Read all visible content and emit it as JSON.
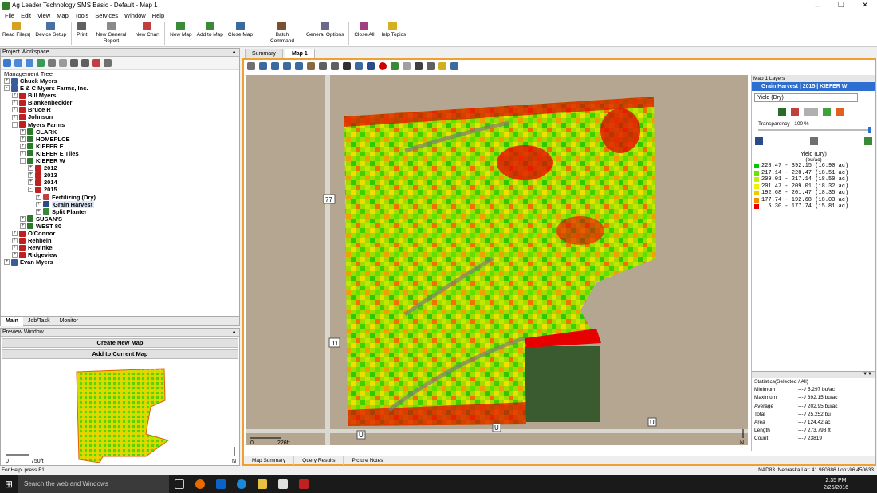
{
  "title": {
    "text": "Ag Leader Technology SMS Basic - Default - Map 1"
  },
  "menu": [
    "File",
    "Edit",
    "View",
    "Map",
    "Tools",
    "Services",
    "Window",
    "Help"
  ],
  "ribbon": [
    {
      "label": "Read File(s)",
      "icon": "folder-icon",
      "color": "#d6a020"
    },
    {
      "label": "Device Setup",
      "icon": "device-icon",
      "color": "#4a6fa5"
    },
    {
      "label": "Print",
      "icon": "print-icon",
      "color": "#606060"
    },
    {
      "label": "New General Report",
      "icon": "report-icon",
      "color": "#8a8a8a"
    },
    {
      "label": "New Chart",
      "icon": "chart-icon",
      "color": "#c04040"
    },
    {
      "label": "New Map",
      "icon": "new-map-icon",
      "color": "#3a8a3a"
    },
    {
      "label": "Add to Map",
      "icon": "add-map-icon",
      "color": "#3a8a3a"
    },
    {
      "label": "Close Map",
      "icon": "close-map-icon",
      "color": "#3a6aa0"
    },
    {
      "label": "Batch Command",
      "icon": "batch-icon",
      "color": "#7a5030"
    },
    {
      "label": "General Options",
      "icon": "options-icon",
      "color": "#6a6a8a"
    },
    {
      "label": "Close All",
      "icon": "close-all-icon",
      "color": "#a04080"
    },
    {
      "label": "Help Topics",
      "icon": "help-icon",
      "color": "#d4b020"
    }
  ],
  "workspace": {
    "title": "Project Workspace",
    "tree_label": "Management Tree",
    "nodes": [
      {
        "label": "Chuck Myers",
        "depth": 0,
        "exp": "+",
        "icon": "person-icon"
      },
      {
        "label": "E & C Myers Farms, Inc.",
        "depth": 0,
        "exp": "-",
        "icon": "person-icon"
      },
      {
        "label": "Bill Myers",
        "depth": 1,
        "exp": "+",
        "icon": "farm-icon"
      },
      {
        "label": "Blankenbeckler",
        "depth": 1,
        "exp": "+",
        "icon": "farm-icon"
      },
      {
        "label": "Bruce R",
        "depth": 1,
        "exp": "+",
        "icon": "farm-icon"
      },
      {
        "label": "Johnson",
        "depth": 1,
        "exp": "+",
        "icon": "farm-icon"
      },
      {
        "label": "Myers Farms",
        "depth": 1,
        "exp": "-",
        "icon": "farm-icon"
      },
      {
        "label": "CLARK",
        "depth": 2,
        "exp": "+",
        "icon": "field-icon"
      },
      {
        "label": "HOMEPLCE",
        "depth": 2,
        "exp": "+",
        "icon": "field-icon"
      },
      {
        "label": "KIEFER E",
        "depth": 2,
        "exp": "+",
        "icon": "field-icon"
      },
      {
        "label": "KIEFER E Tiles",
        "depth": 2,
        "exp": "+",
        "icon": "field-icon"
      },
      {
        "label": "KIEFER W",
        "depth": 2,
        "exp": "-",
        "icon": "field-icon"
      },
      {
        "label": "2012",
        "depth": 3,
        "exp": "+",
        "icon": "year-icon"
      },
      {
        "label": "2013",
        "depth": 3,
        "exp": "+",
        "icon": "year-icon"
      },
      {
        "label": "2014",
        "depth": 3,
        "exp": "+",
        "icon": "year-icon"
      },
      {
        "label": "2015",
        "depth": 3,
        "exp": "-",
        "icon": "year-icon"
      },
      {
        "label": "Fertilizing (Dry)",
        "depth": 4,
        "exp": "+",
        "icon": "fertilizer-icon"
      },
      {
        "label": "Grain Harvest",
        "depth": 4,
        "exp": "+",
        "icon": "harvest-icon",
        "selected": true
      },
      {
        "label": "Split Planter",
        "depth": 4,
        "exp": "+",
        "icon": "planter-icon"
      },
      {
        "label": "SUSAN'S",
        "depth": 2,
        "exp": "+",
        "icon": "field-icon"
      },
      {
        "label": "WEST 80",
        "depth": 2,
        "exp": "+",
        "icon": "field-icon"
      },
      {
        "label": "O'Connor",
        "depth": 1,
        "exp": "+",
        "icon": "farm-icon"
      },
      {
        "label": "Rehbein",
        "depth": 1,
        "exp": "+",
        "icon": "farm-icon"
      },
      {
        "label": "Rewinkel",
        "depth": 1,
        "exp": "+",
        "icon": "farm-icon"
      },
      {
        "label": "Ridgeview",
        "depth": 1,
        "exp": "+",
        "icon": "farm-icon"
      },
      {
        "label": "Evan Myers",
        "depth": 0,
        "exp": "+",
        "icon": "person-icon"
      }
    ],
    "tabs": [
      "Main",
      "Job/Task",
      "Monitor"
    ]
  },
  "preview": {
    "title": "Preview Window",
    "create_btn": "Create New Map",
    "add_btn": "Add to Current Map",
    "scale_left": "0",
    "scale_right": "750ft",
    "north": "N"
  },
  "map": {
    "tabs": [
      "Summary",
      "Map 1"
    ],
    "road_labels": [
      "77",
      "11",
      "U",
      "U",
      "U"
    ],
    "scale_left": "0",
    "scale_right": "226ft",
    "north": "N",
    "bottom_tabs": [
      "Map Summary",
      "Query Results",
      "Picture Notes"
    ]
  },
  "layers": {
    "title": "Map 1 Layers",
    "layer_name": "Grain Harvest | 2015 | KIEFER W",
    "attribute": "Yield (Dry)",
    "transparency": "Transparency - 100 %",
    "legend_title": "Yield (Dry)",
    "legend_unit": "(bu/ac)",
    "legend": [
      {
        "text": "228.47 - 392.15 (16.90 ac)",
        "color": "#00c800"
      },
      {
        "text": "217.14 - 228.47 (18.51 ac)",
        "color": "#64e600"
      },
      {
        "text": "209.01 - 217.14 (18.50 ac)",
        "color": "#c8f000"
      },
      {
        "text": "201.47 - 209.01 (18.32 ac)",
        "color": "#f0f000"
      },
      {
        "text": "192.68 - 201.47 (18.35 ac)",
        "color": "#f0c800"
      },
      {
        "text": "177.74 - 192.68 (18.03 ac)",
        "color": "#f08c00"
      },
      {
        "text": "  5.30 - 177.74 (15.81 ac)",
        "color": "#e60000"
      }
    ],
    "stats_title": "Statistics(Selected / All)",
    "stats": [
      {
        "k": "Minimum",
        "v": "--- / 5.297 bu/ac"
      },
      {
        "k": "Maximum",
        "v": "--- / 392.15 bu/ac"
      },
      {
        "k": "Average",
        "v": "--- / 202.95 bu/ac"
      },
      {
        "k": "Total",
        "v": "--- / 25,252 bu"
      },
      {
        "k": "Area",
        "v": "--- / 124.42 ac"
      },
      {
        "k": "Length",
        "v": "--- / 273,798 ft"
      },
      {
        "k": "Count",
        "v": "--- / 23819"
      }
    ]
  },
  "status": {
    "left": "For Help, press F1",
    "right": "NAD83 :Nebraska  Lat: 41.980386  Lon:-96.450633"
  },
  "taskbar": {
    "search": "Search the web and Windows",
    "time": "2:35 PM",
    "date": "2/26/2016"
  }
}
